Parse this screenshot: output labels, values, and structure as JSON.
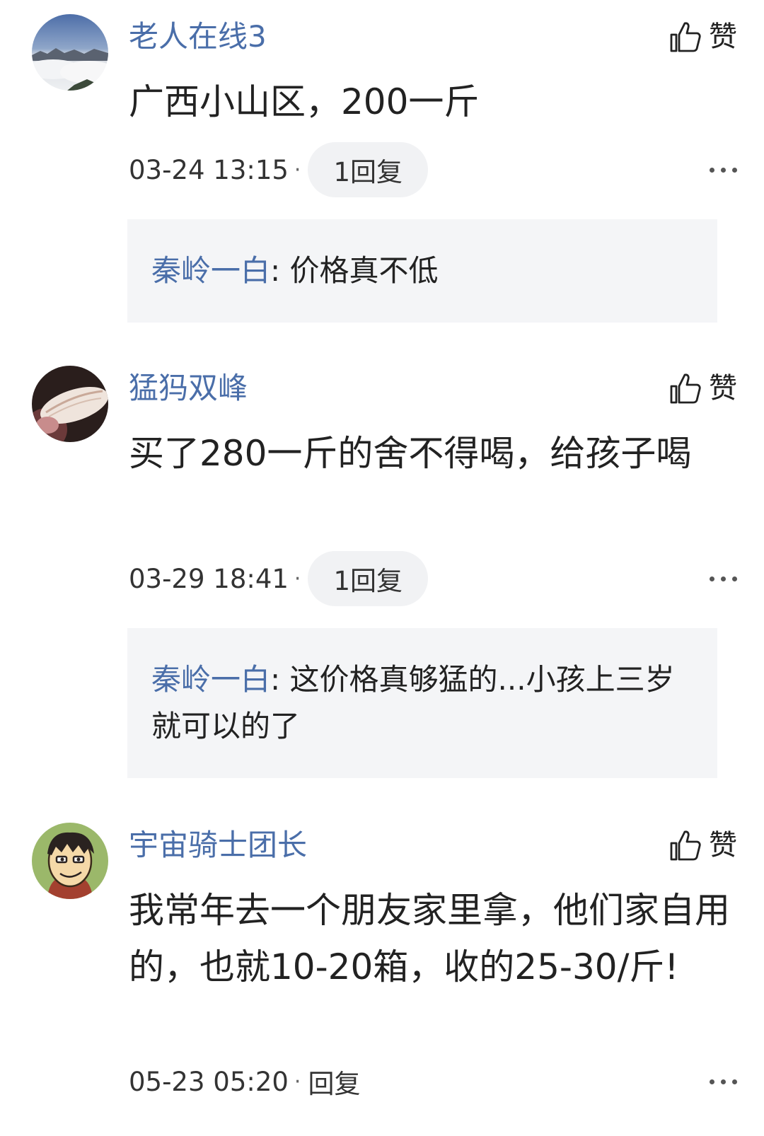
{
  "comments": [
    {
      "username": "老人在线3",
      "content": "广西小山区，200一斤",
      "time": "03-24 13:15",
      "separator": "·",
      "reply_label": "1回复",
      "like_label": "赞",
      "reply": {
        "name": "秦岭一白",
        "colon": ": ",
        "text": "价格真不低"
      }
    },
    {
      "username": "猛犸双峰",
      "content": "买了280一斤的舍不得喝，给孩子喝",
      "time": "03-29 18:41",
      "separator": "·",
      "reply_label": "1回复",
      "like_label": "赞",
      "reply": {
        "name": "秦岭一白",
        "colon": ": ",
        "text": "这价格真够猛的...小孩上三岁就可以的了"
      }
    },
    {
      "username": "宇宙骑士团长",
      "content": "我常年去一个朋友家里拿，他们家自用的，也就10-20箱，收的25-30/斤!",
      "time": "05-23 05:20",
      "separator": "·",
      "reply_label": "回复",
      "like_label": "赞"
    }
  ],
  "icons": {
    "like": "thumbs-up-icon",
    "more": "more-dots-icon"
  },
  "colors": {
    "username": "#4a6ea9",
    "text": "#222222",
    "reply_background": "#f4f5f7",
    "pill_background": "#f1f2f4"
  }
}
